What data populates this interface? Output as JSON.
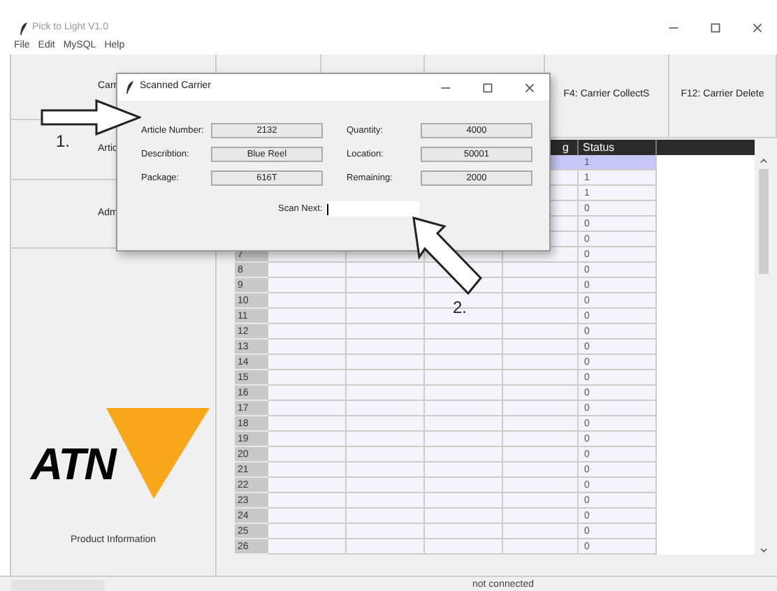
{
  "window": {
    "title": "Pick to Light V1.0"
  },
  "menu": [
    "File",
    "Edit",
    "MySQL",
    "Help"
  ],
  "sidebar": {
    "buttons": [
      {
        "label": "Carr"
      },
      {
        "label": "Artic"
      },
      {
        "label": "Adm"
      }
    ],
    "logo": "ATN",
    "footer": "Product Information"
  },
  "toolbar": [
    {
      "label": "F4: Carrier CollectS"
    },
    {
      "label": "F12: Carrier Delete"
    }
  ],
  "table": {
    "header": {
      "column_5": "g",
      "column_6": "Status"
    },
    "rows": [
      {
        "status": "1",
        "selected": true
      },
      {
        "status": "1",
        "selected": false
      },
      {
        "status": "1",
        "selected": false
      },
      {
        "status": "0",
        "selected": false
      },
      {
        "status": "0",
        "selected": false
      },
      {
        "status": "0",
        "selected": false
      },
      {
        "number": "7",
        "status": "0",
        "selected": false
      },
      {
        "number": "8",
        "status": "0",
        "selected": false
      },
      {
        "number": "9",
        "status": "0",
        "selected": false
      },
      {
        "number": "10",
        "status": "0",
        "selected": false
      },
      {
        "number": "11",
        "status": "0",
        "selected": false
      },
      {
        "number": "12",
        "status": "0",
        "selected": false
      },
      {
        "number": "13",
        "status": "0",
        "selected": false
      },
      {
        "number": "14",
        "status": "0",
        "selected": false
      },
      {
        "number": "15",
        "status": "0",
        "selected": false
      },
      {
        "number": "16",
        "status": "0",
        "selected": false
      },
      {
        "number": "17",
        "status": "0",
        "selected": false
      },
      {
        "number": "18",
        "status": "0",
        "selected": false
      },
      {
        "number": "19",
        "status": "0",
        "selected": false
      },
      {
        "number": "20",
        "status": "0",
        "selected": false
      },
      {
        "number": "21",
        "status": "0",
        "selected": false
      },
      {
        "number": "22",
        "status": "0",
        "selected": false
      },
      {
        "number": "23",
        "status": "0",
        "selected": false
      },
      {
        "number": "24",
        "status": "0",
        "selected": false
      },
      {
        "number": "25",
        "status": "0",
        "selected": false
      },
      {
        "number": "26",
        "status": "0",
        "selected": false
      }
    ]
  },
  "status_bar": "not connected",
  "dialog": {
    "title": "Scanned Carrier",
    "left_fields": [
      {
        "label": "Article Number:",
        "value": "2132"
      },
      {
        "label": "Describtion:",
        "value": "Blue Reel"
      },
      {
        "label": "Package:",
        "value": "616T"
      }
    ],
    "right_fields": [
      {
        "label": "Quantity:",
        "value": "4000"
      },
      {
        "label": "Location:",
        "value": "50001"
      },
      {
        "label": "Remaining:",
        "value": "2000"
      }
    ],
    "scan": {
      "label": "Scan Next:"
    }
  },
  "annotations": [
    {
      "label": "1."
    },
    {
      "label": "2."
    }
  ]
}
